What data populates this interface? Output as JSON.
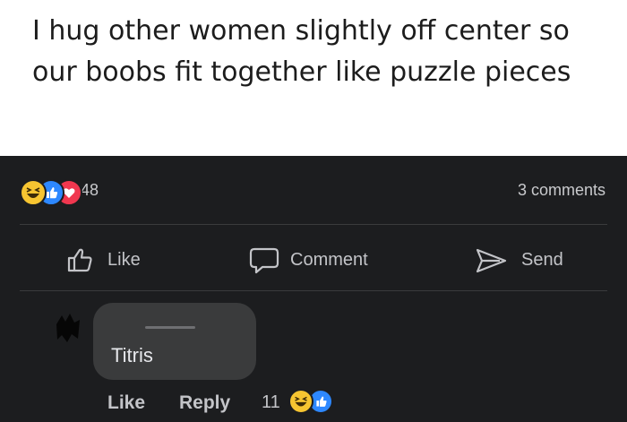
{
  "caption": {
    "text": "I hug other women slightly off center so our boobs fit together like puzzle pieces"
  },
  "post": {
    "reaction_icons": [
      "haha-icon",
      "like-icon",
      "love-icon"
    ],
    "reaction_count": "48",
    "comment_count": "3 comments"
  },
  "actions": {
    "like_label": "Like",
    "comment_label": "Comment",
    "send_label": "Send"
  },
  "comment": {
    "text": "Titris",
    "like_label": "Like",
    "reply_label": "Reply",
    "reaction_count": "11",
    "reaction_icons": [
      "haha-icon",
      "like-icon"
    ]
  },
  "colors": {
    "panel_background": "#1c1d1f",
    "bubble_background": "#3a3b3c",
    "like_blue": "#2d88ff",
    "love_red": "#f0374f",
    "haha_yellow": "#f7c531"
  }
}
